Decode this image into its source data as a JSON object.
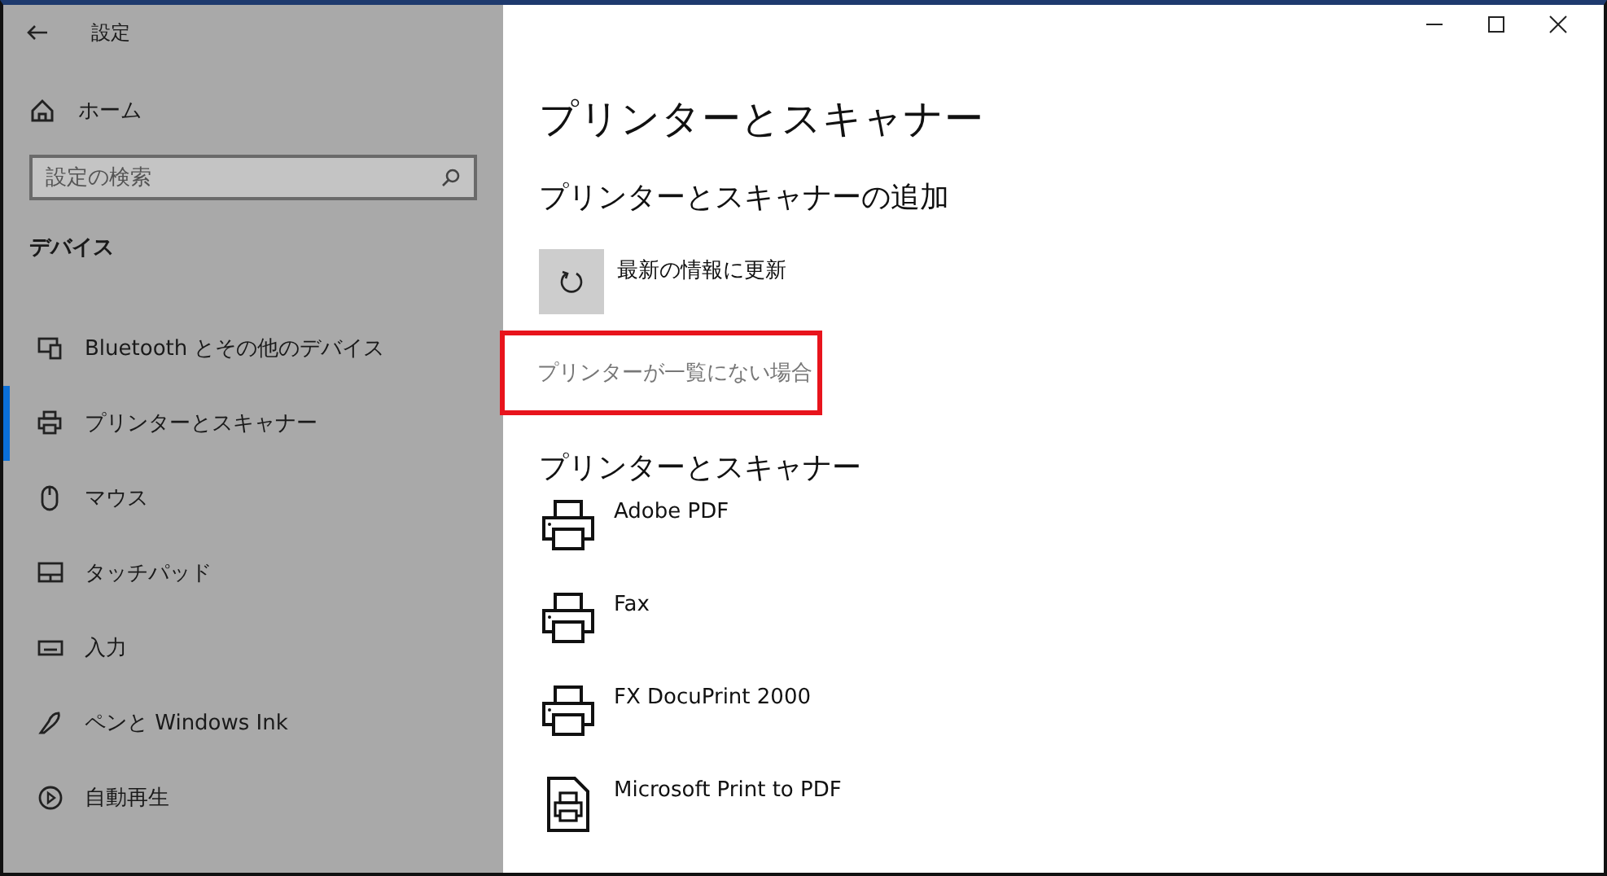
{
  "window": {
    "title": "設定"
  },
  "sidebar": {
    "home": "ホーム",
    "search": {
      "placeholder": "設定の検索"
    },
    "section": "デバイス",
    "items": [
      {
        "label": "Bluetooth とその他のデバイス",
        "selected": false
      },
      {
        "label": "プリンターとスキャナー",
        "selected": true
      },
      {
        "label": "マウス",
        "selected": false
      },
      {
        "label": "タッチパッド",
        "selected": false
      },
      {
        "label": "入力",
        "selected": false
      },
      {
        "label": "ペンと Windows Ink",
        "selected": false
      },
      {
        "label": "自動再生",
        "selected": false
      }
    ]
  },
  "content": {
    "title": "プリンターとスキャナー",
    "add_heading": "プリンターとスキャナーの追加",
    "refresh": "最新の情報に更新",
    "not_listed_link": "プリンターが一覧にない場合",
    "list_heading": "プリンターとスキャナー",
    "printers": [
      {
        "name": "Adobe PDF",
        "kind": "printer"
      },
      {
        "name": "Fax",
        "kind": "printer"
      },
      {
        "name": "FX DocuPrint 2000",
        "kind": "printer"
      },
      {
        "name": "Microsoft Print to PDF",
        "kind": "document"
      }
    ]
  }
}
